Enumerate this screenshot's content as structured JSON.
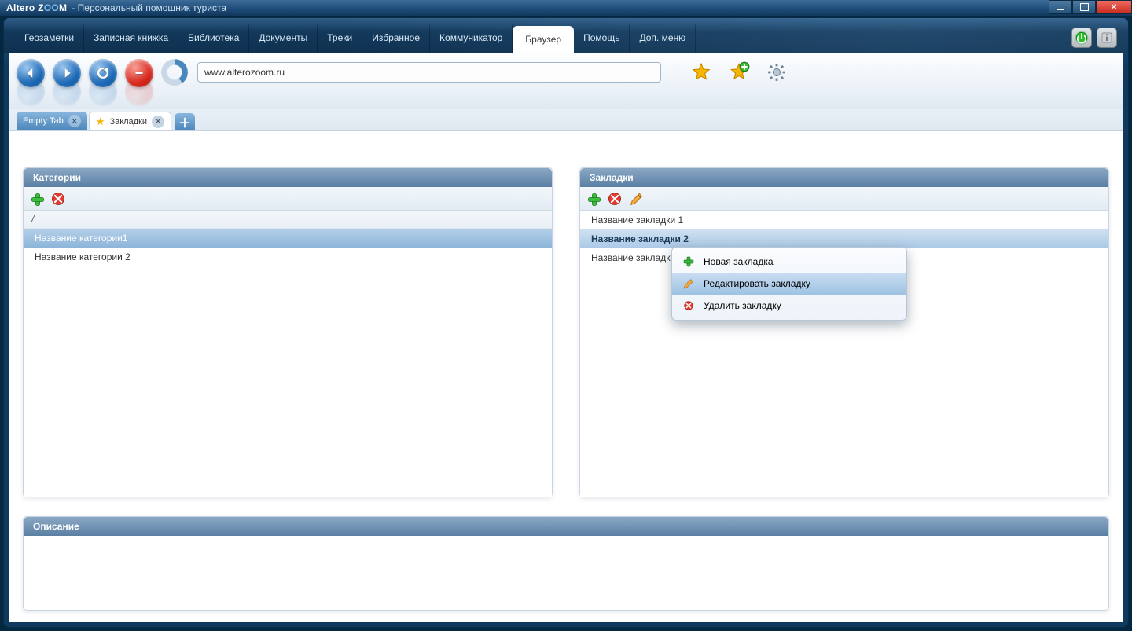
{
  "title": {
    "brand_prefix": "Altero Z",
    "brand_mid": "OO",
    "brand_suffix": "M",
    "subtitle": "- Персональный помощник туриста"
  },
  "menu": {
    "items": [
      "Геозаметки",
      "Записная книжка",
      "Библиотека",
      "Документы",
      "Треки",
      "Избранное",
      "Коммуникатор",
      "Браузер",
      "Помощь",
      "Доп. меню"
    ],
    "activeIndex": 7
  },
  "toolbar": {
    "url": "www.alterozoom.ru"
  },
  "tabs": {
    "items": [
      {
        "label": "Empty Tab",
        "active": false
      },
      {
        "label": "Закладки",
        "active": true
      }
    ]
  },
  "panels": {
    "categories": {
      "title": "Категории",
      "root": "/",
      "rows": [
        "Название категории1",
        "Название категории 2"
      ],
      "selected": 0
    },
    "bookmarks": {
      "title": "Закладки",
      "rows": [
        "Название закладки 1",
        "Название закладки 2",
        "Название закладки 3"
      ],
      "selected": 1
    },
    "description": {
      "title": "Описание"
    }
  },
  "contextMenu": {
    "items": [
      {
        "icon": "plus",
        "label": "Новая закладка"
      },
      {
        "icon": "edit",
        "label": "Редактировать закладку"
      },
      {
        "icon": "delete",
        "label": "Удалить закладку"
      }
    ],
    "hoverIndex": 1
  }
}
